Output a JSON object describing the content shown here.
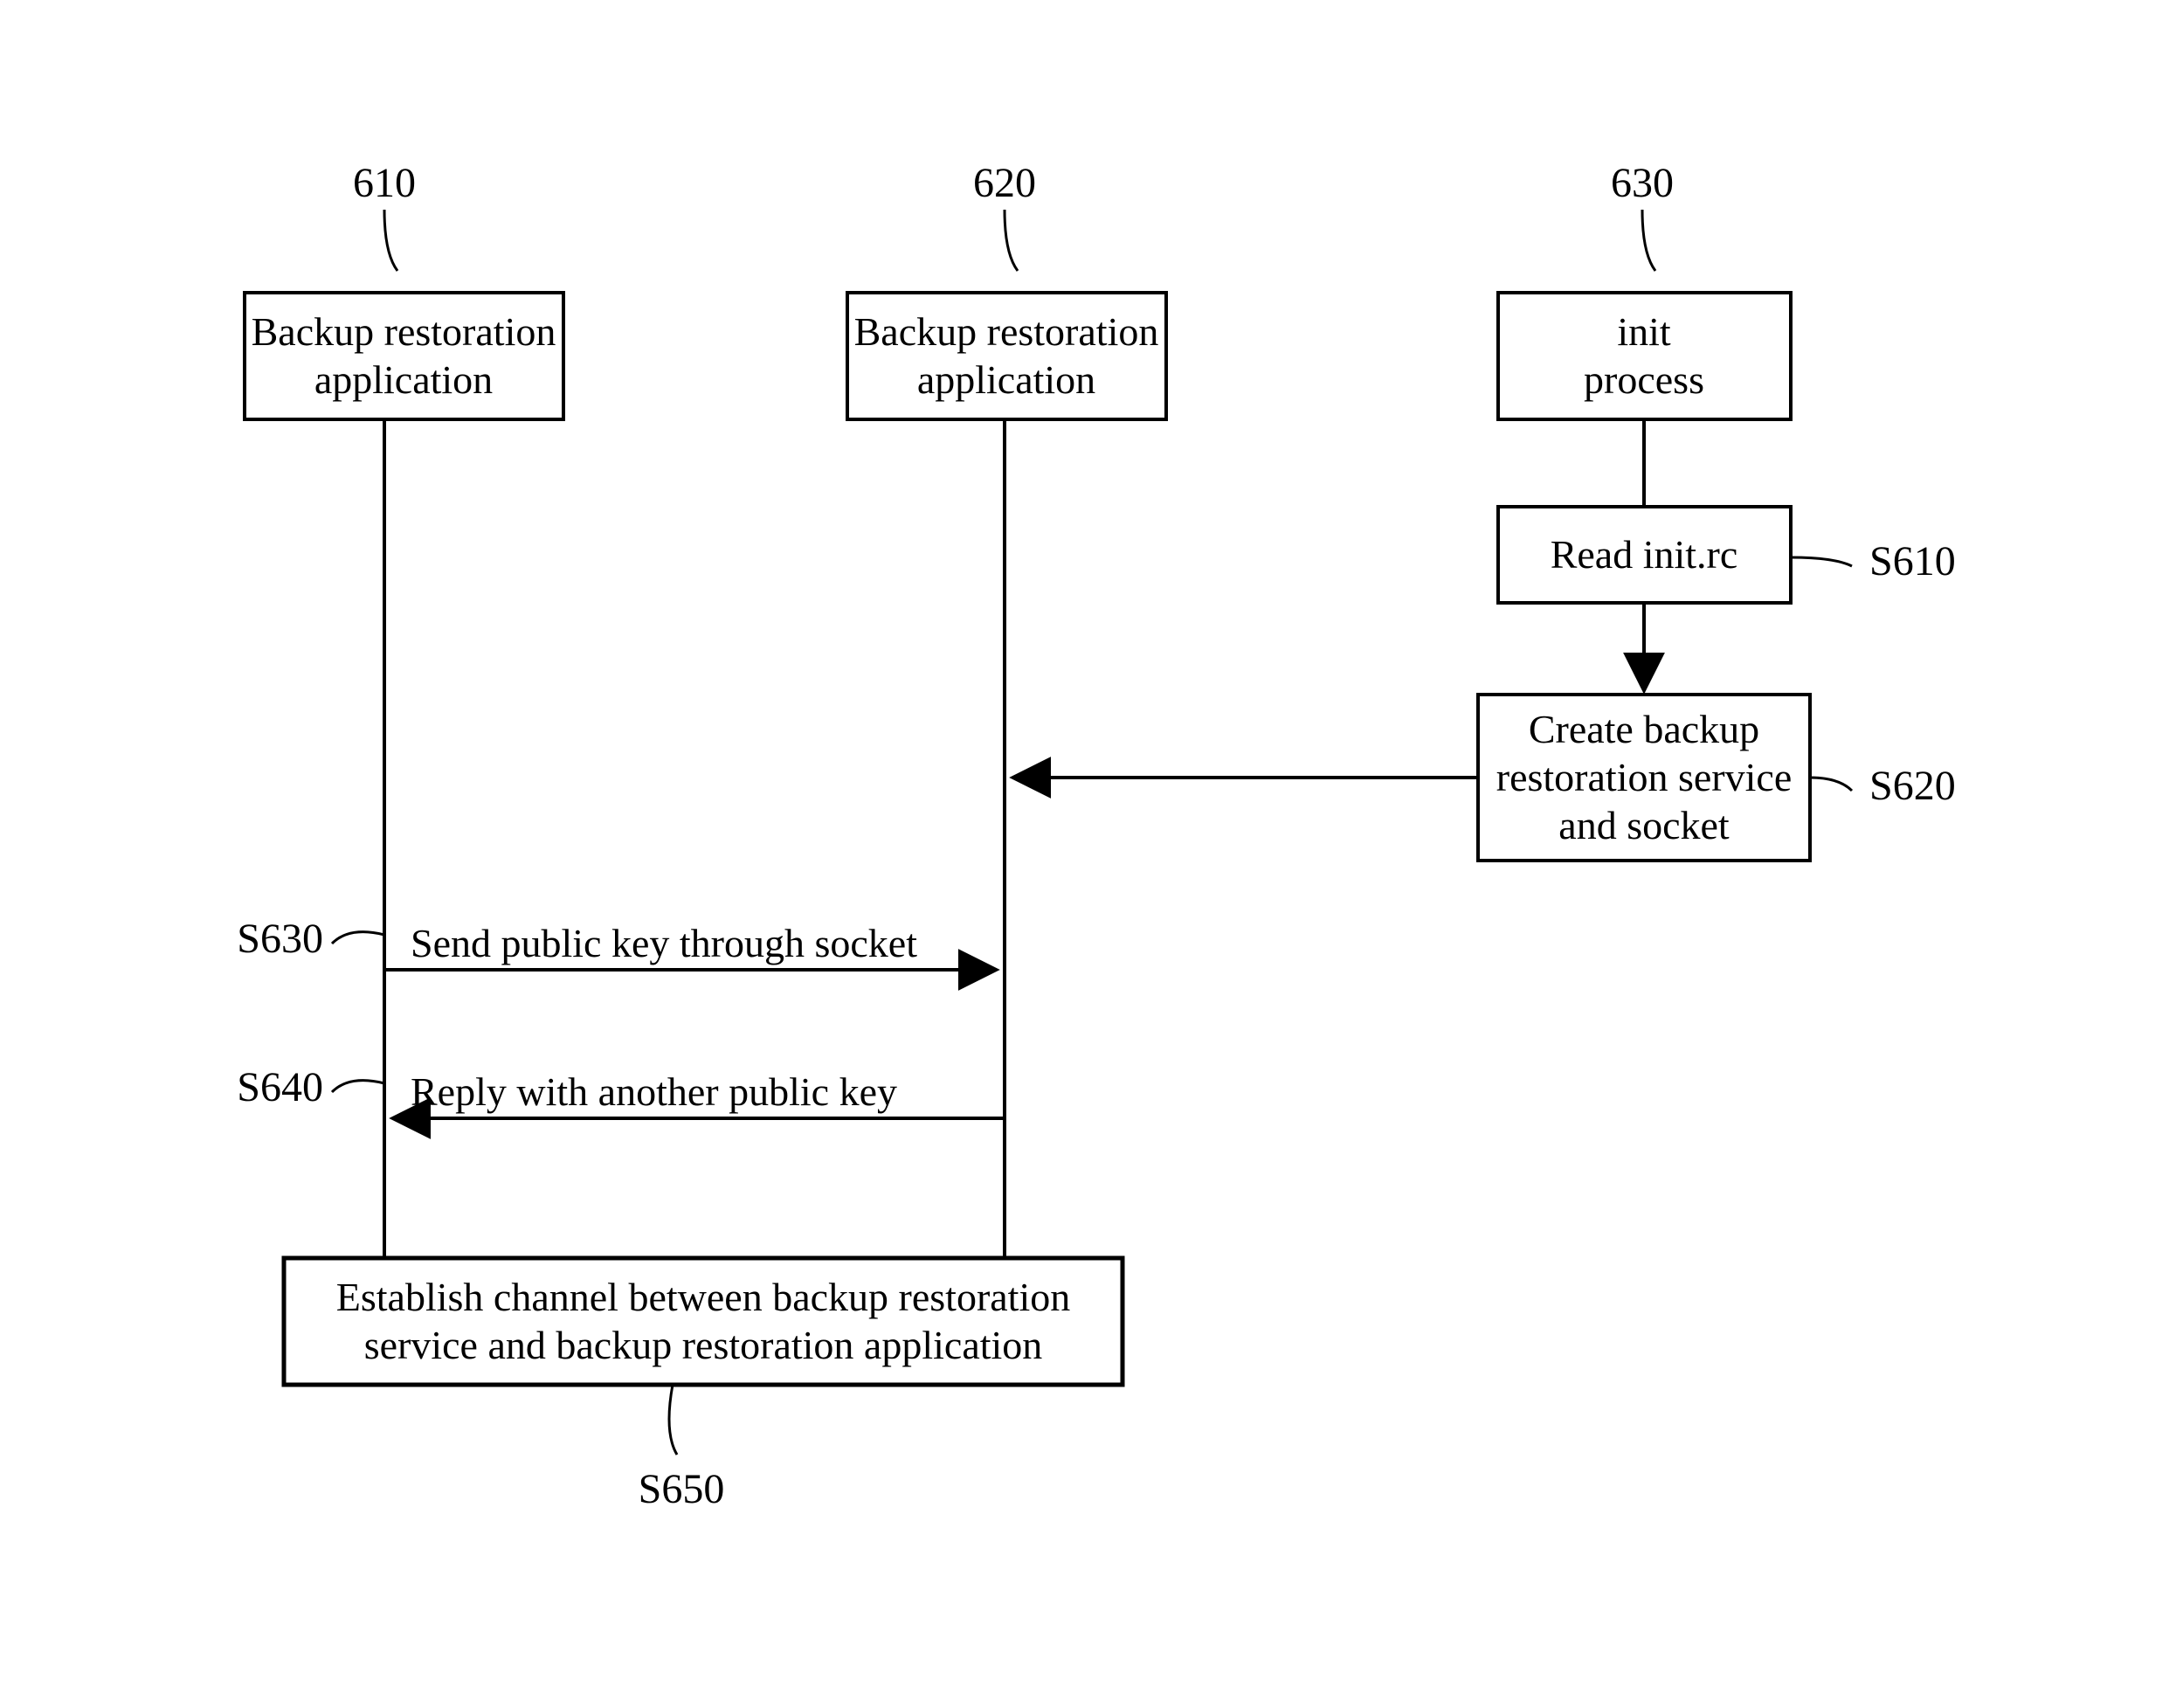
{
  "actors": {
    "left": {
      "id": "610",
      "line1": "Backup restoration",
      "line2": "application"
    },
    "middle": {
      "id": "620",
      "line1": "Backup restoration",
      "line2": "application"
    },
    "right": {
      "id": "630",
      "line1": "init",
      "line2": "process"
    }
  },
  "steps": {
    "s610": {
      "id": "S610",
      "text": "Read init.rc"
    },
    "s620": {
      "id": "S620",
      "line1": "Create backup",
      "line2": "restoration service",
      "line3": "and socket"
    },
    "s630": {
      "id": "S630",
      "text": "Send public key through socket"
    },
    "s640": {
      "id": "S640",
      "text": "Reply with another public key"
    },
    "s650": {
      "id": "S650",
      "line1": "Establish channel between backup restoration",
      "line2": "service and backup restoration application"
    }
  }
}
